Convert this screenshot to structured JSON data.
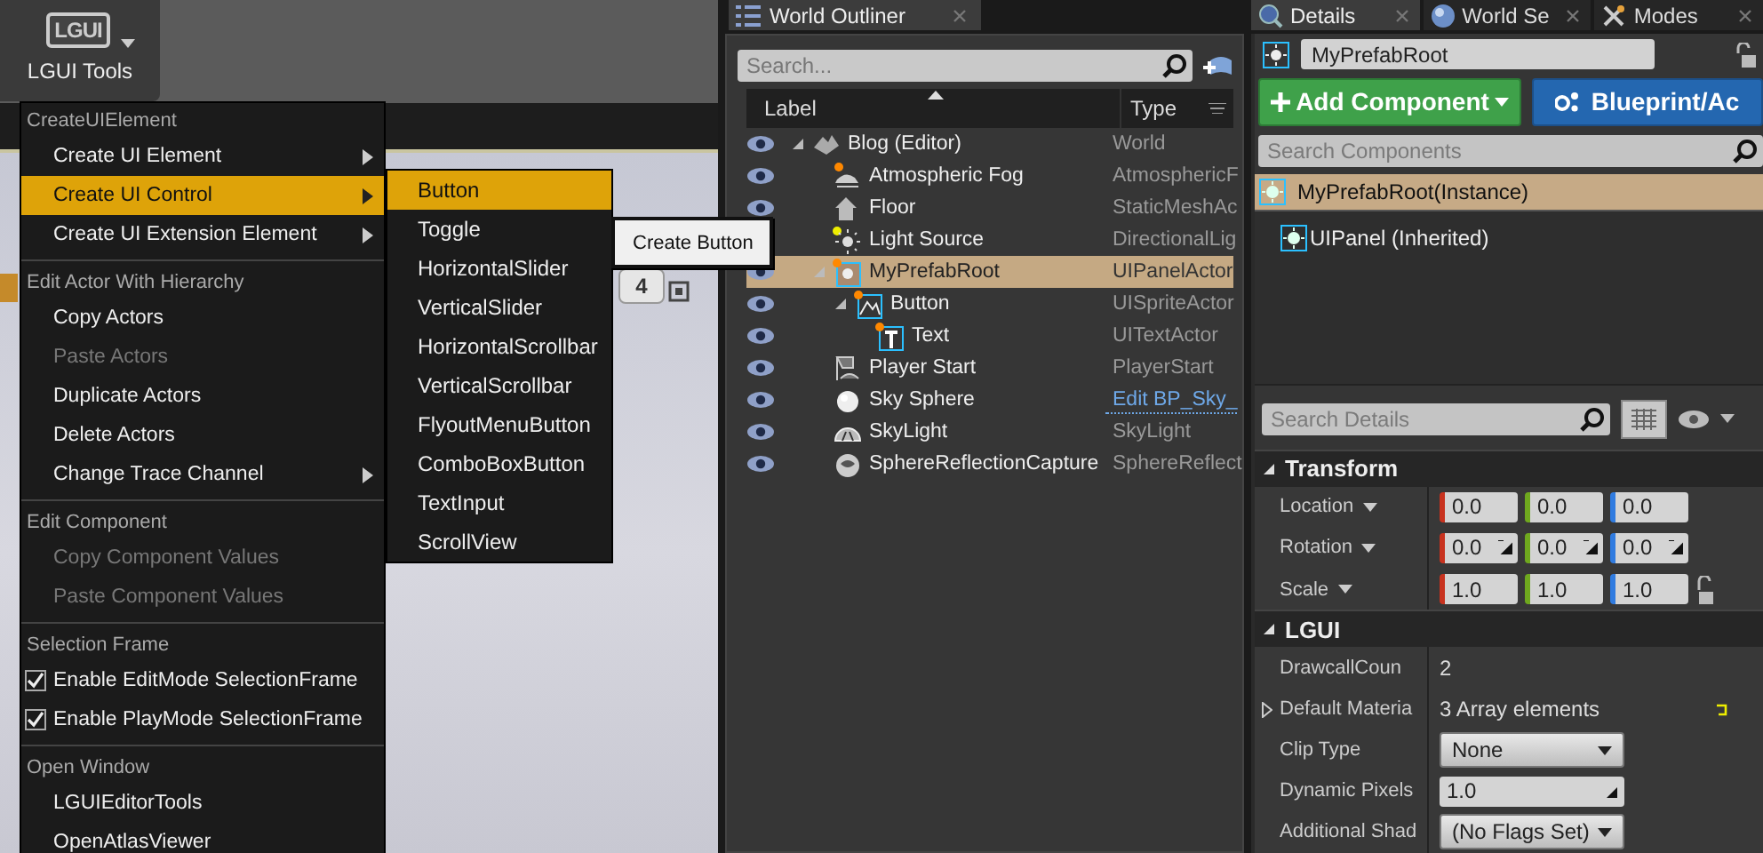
{
  "toolbar": {
    "logo": "LGUI",
    "tool_button": "LGUI Tools"
  },
  "viewport": {
    "view_button": "4"
  },
  "context_menu": {
    "sections": [
      {
        "header": "CreateUIElement",
        "items": [
          {
            "label": "Create UI Element",
            "kind": "submenu",
            "selected": false,
            "disabled": false
          },
          {
            "label": "Create UI Control",
            "kind": "submenu",
            "selected": true,
            "disabled": false
          },
          {
            "label": "Create UI Extension Element",
            "kind": "submenu",
            "selected": false,
            "disabled": false
          }
        ]
      },
      {
        "header": "Edit Actor With Hierarchy",
        "items": [
          {
            "label": "Copy Actors",
            "kind": "command",
            "selected": false,
            "disabled": false
          },
          {
            "label": "Paste Actors",
            "kind": "command",
            "selected": false,
            "disabled": true
          },
          {
            "label": "Duplicate Actors",
            "kind": "command",
            "selected": false,
            "disabled": false
          },
          {
            "label": "Delete Actors",
            "kind": "command",
            "selected": false,
            "disabled": false
          },
          {
            "label": "Change Trace Channel",
            "kind": "submenu",
            "selected": false,
            "disabled": false
          }
        ]
      },
      {
        "header": "Edit Component",
        "items": [
          {
            "label": "Copy Component Values",
            "kind": "command",
            "selected": false,
            "disabled": true
          },
          {
            "label": "Paste Component Values",
            "kind": "command",
            "selected": false,
            "disabled": true
          }
        ]
      },
      {
        "header": "Selection Frame",
        "items": [
          {
            "label": "Enable EditMode SelectionFrame",
            "kind": "checkbox",
            "checked": true,
            "selected": false,
            "disabled": false
          },
          {
            "label": "Enable PlayMode SelectionFrame",
            "kind": "checkbox",
            "checked": true,
            "selected": false,
            "disabled": false
          }
        ]
      },
      {
        "header": "Open Window",
        "items": [
          {
            "label": "LGUIEditorTools",
            "kind": "command",
            "selected": false,
            "disabled": false
          },
          {
            "label": "OpenAtlasViewer",
            "kind": "command",
            "selected": false,
            "disabled": false
          }
        ]
      }
    ]
  },
  "submenu": {
    "items": [
      {
        "label": "Button",
        "selected": true
      },
      {
        "label": "Toggle",
        "selected": false
      },
      {
        "label": "HorizontalSlider",
        "selected": false
      },
      {
        "label": "VerticalSlider",
        "selected": false
      },
      {
        "label": "HorizontalScrollbar",
        "selected": false
      },
      {
        "label": "VerticalScrollbar",
        "selected": false
      },
      {
        "label": "FlyoutMenuButton",
        "selected": false
      },
      {
        "label": "ComboBoxButton",
        "selected": false
      },
      {
        "label": "TextInput",
        "selected": false
      },
      {
        "label": "ScrollView",
        "selected": false
      }
    ]
  },
  "tooltip": "Create Button",
  "world_outliner": {
    "tab": "World Outliner",
    "search": {
      "placeholder": "Search..."
    },
    "columns": [
      "Label",
      "Type"
    ],
    "rows": [
      {
        "label": "Blog (Editor)",
        "type": "World",
        "kind": "world",
        "selected": false,
        "type_link": false,
        "expanded": true,
        "children": [
          {
            "label": "Atmospheric Fog",
            "type": "AtmosphericF",
            "kind": "fog",
            "selected": false,
            "type_link": false
          },
          {
            "label": "Floor",
            "type": "StaticMeshAc",
            "kind": "mesh",
            "selected": false,
            "type_link": false
          },
          {
            "label": "Light Source",
            "type": "DirectionalLig",
            "kind": "light",
            "selected": false,
            "type_link": false
          },
          {
            "label": "MyPrefabRoot",
            "type": "UIPanelActor",
            "kind": "panel",
            "selected": true,
            "type_link": false,
            "expanded": true,
            "children": [
              {
                "label": "Button",
                "type": "UISpriteActor",
                "kind": "sprite",
                "selected": false,
                "type_link": false,
                "expanded": true,
                "children": [
                  {
                    "label": "Text",
                    "type": "UITextActor",
                    "kind": "text",
                    "selected": false,
                    "type_link": false
                  }
                ]
              }
            ]
          },
          {
            "label": "Player Start",
            "type": "PlayerStart",
            "kind": "player_start",
            "selected": false,
            "type_link": false
          },
          {
            "label": "Sky Sphere",
            "type": "Edit BP_Sky_",
            "kind": "sphere",
            "selected": false,
            "type_link": true
          },
          {
            "label": "SkyLight",
            "type": "SkyLight",
            "kind": "skylight",
            "selected": false,
            "type_link": false
          },
          {
            "label": "SphereReflectionCapture",
            "type": "SphereReflect",
            "kind": "reflection",
            "selected": false,
            "type_link": false
          }
        ]
      }
    ]
  },
  "details": {
    "tabs": [
      {
        "label": "Details",
        "kind": "details",
        "selected": true
      },
      {
        "label": "World Se",
        "kind": "world",
        "selected": false
      },
      {
        "label": "Modes",
        "kind": "modes",
        "selected": false
      }
    ],
    "name_field": "MyPrefabRoot",
    "add_component": "Add Component",
    "blueprint_button": "Blueprint/Ac",
    "component_search": {
      "placeholder": "Search Components"
    },
    "components": [
      {
        "label": "MyPrefabRoot(Instance)",
        "selected": true,
        "children": [
          {
            "label": "UIPanel (Inherited)",
            "selected": false
          }
        ]
      }
    ],
    "details_search": {
      "placeholder": "Search Details"
    },
    "sections": [
      {
        "title": "Transform",
        "rows": [
          {
            "label": "Location",
            "kind": "vector",
            "values": [
              "0.0",
              "0.0",
              "0.0"
            ]
          },
          {
            "label": "Rotation",
            "kind": "rotator",
            "values": [
              "0.0",
              "0.0",
              "0.0"
            ]
          },
          {
            "label": "Scale",
            "kind": "scale",
            "values": [
              "1.0",
              "1.0",
              "1.0"
            ]
          }
        ]
      },
      {
        "title": "LGUI",
        "rows": [
          {
            "label": "DrawcallCoun",
            "kind": "text",
            "value": "2"
          },
          {
            "label": "Default Materia",
            "kind": "array",
            "value": "3 Array elements"
          },
          {
            "label": "Clip Type",
            "kind": "dropdown",
            "value": "None"
          },
          {
            "label": "Dynamic Pixels",
            "kind": "number",
            "value": "1.0"
          },
          {
            "label": "Additional Shad",
            "kind": "dropdown",
            "value": "(No Flags Set)"
          }
        ]
      }
    ]
  }
}
